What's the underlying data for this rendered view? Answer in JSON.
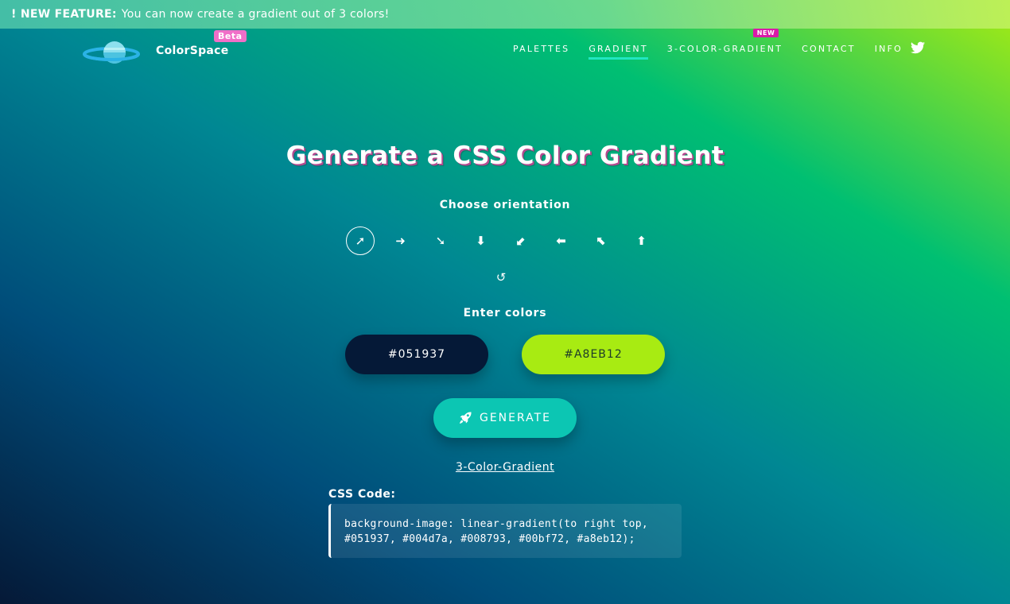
{
  "banner": {
    "prefix": "! NEW FEATURE:",
    "message": "You can now create a gradient out of 3 colors!"
  },
  "brand": {
    "name": "ColorSpace",
    "badge": "Beta",
    "logo_icon": "planet-icon"
  },
  "nav": {
    "items": [
      {
        "label": "PALETTES",
        "active": false
      },
      {
        "label": "GRADIENT",
        "active": true
      },
      {
        "label": "3-COLOR-GRADIENT",
        "active": false,
        "badge": "NEW"
      },
      {
        "label": "CONTACT",
        "active": false
      },
      {
        "label": "INFO",
        "active": false
      }
    ],
    "social_icon": "twitter-icon"
  },
  "main": {
    "title": "Generate a CSS Color Gradient",
    "orientation_label": "Choose orientation",
    "orientations": [
      {
        "icon": "arrow-up-right-icon",
        "glyph": "➚",
        "selected": true
      },
      {
        "icon": "arrow-right-icon",
        "glyph": "➜",
        "selected": false
      },
      {
        "icon": "arrow-down-right-icon",
        "glyph": "➘",
        "selected": false
      },
      {
        "icon": "arrow-down-icon",
        "glyph": "⬇",
        "selected": false
      },
      {
        "icon": "arrow-down-left-icon",
        "glyph": "⬋",
        "selected": false
      },
      {
        "icon": "arrow-left-icon",
        "glyph": "⬅",
        "selected": false
      },
      {
        "icon": "arrow-up-left-icon",
        "glyph": "⬉",
        "selected": false
      },
      {
        "icon": "arrow-up-icon",
        "glyph": "⬆",
        "selected": false
      }
    ],
    "reset_icon": "refresh-icon",
    "reset_glyph": "↺",
    "colors_label": "Enter colors",
    "color1": {
      "value": "#051937",
      "bg": "#051937",
      "text_color": "#ffffff"
    },
    "color2": {
      "value": "#A8EB12",
      "bg": "#a8eb12",
      "text_color": "#1d3a2a"
    },
    "generate_label": "GENERATE",
    "generate_icon": "rocket-icon",
    "three_color_link": "3-Color-Gradient",
    "css_code_label": "CSS Code:",
    "css_code": "background-image: linear-gradient(to right top,\n#051937, #004d7a, #008793, #00bf72, #a8eb12);"
  },
  "colors": {
    "accent": "#21e6c1",
    "generate_button": "#0cc6b3",
    "beta_badge": "#f06fc8",
    "new_badge": "#d91aa8",
    "title_shadow": "#b44a8f"
  }
}
